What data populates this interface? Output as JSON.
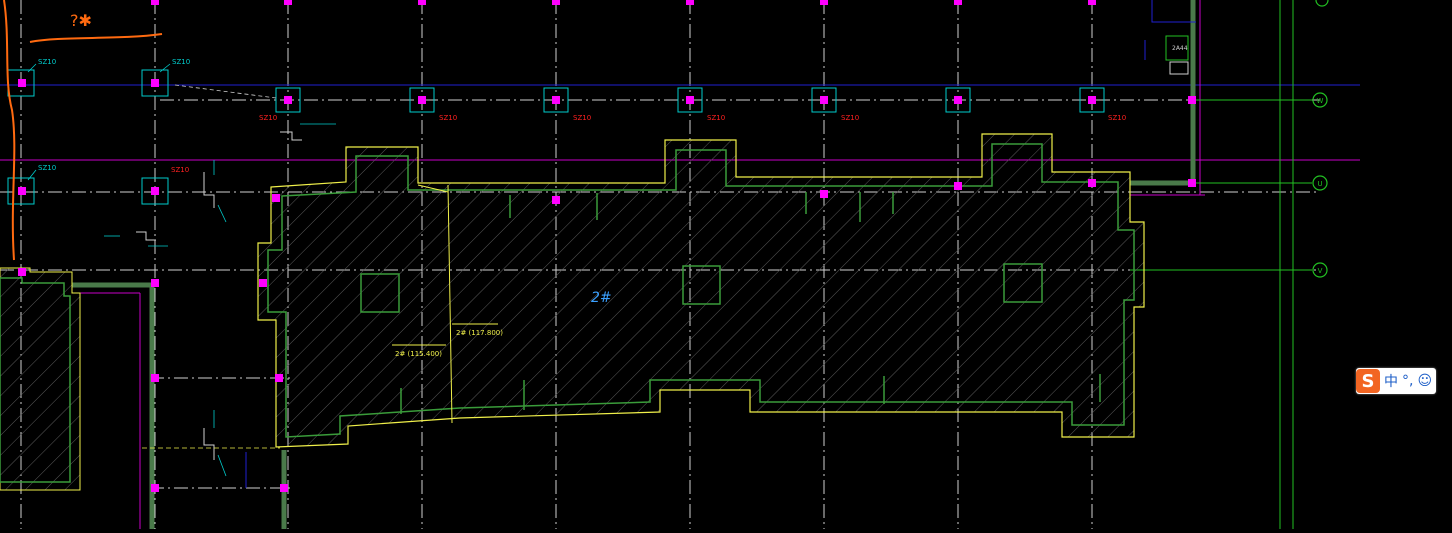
{
  "drawing": {
    "building_label": "2#",
    "elevation_left": "2# (115.400)",
    "elevation_right": "2# (117.800)",
    "column_tags": [
      "SZ10",
      "SZ10",
      "SZ10",
      "SZ10",
      "SZ10",
      "SZ10",
      "SZ10",
      "SZ10",
      "SZ10",
      "SZ10"
    ],
    "axis_bubbles": [
      "W",
      "U",
      "V"
    ],
    "detail_note": "2A44",
    "handwritten_mark": "?✱"
  },
  "colors": {
    "background": "#000000",
    "grid_dashdot": "#d8d8d8",
    "outline_yellow": "#f0f04a",
    "inner_green": "#3a9c3a",
    "column_cyan": "#00cccc",
    "column_magenta": "#ff00ff",
    "magenta_line": "#c800c8",
    "blue_line": "#1f1fd0",
    "green_axis": "#22c022",
    "red_tag": "#ff2020",
    "orange_markup": "#ff6a10"
  },
  "ime": {
    "logo": "S",
    "lang": "中",
    "punct": "°,",
    "emoji": "☺"
  }
}
